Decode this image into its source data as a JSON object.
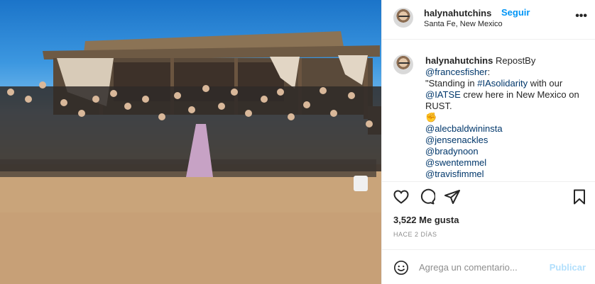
{
  "post": {
    "username": "halynahutchins",
    "separator": "•",
    "follow_label": "Seguir",
    "location": "Santa Fe, New Mexico",
    "more_label": "•••",
    "photo_description": ""
  },
  "caption": {
    "username": "halynahutchins",
    "repost_by": "RepostBy",
    "mention_source": "@francesfisher",
    "line1_suffix": ":",
    "quote_open": "\"Standing in ",
    "hashtag": "#IAsolidarity",
    "quote_mid": " with our",
    "mention_iatse": "@IATSE",
    "quote_end": " crew here in New Mexico on",
    "quote_last": "RUST.",
    "emoji": "✊",
    "mentions": [
      "@alecbaldwininsta",
      "@jensenackles",
      "@bradynoon",
      "@swentemmel",
      "@travisfimmel"
    ]
  },
  "actions": {
    "like_icon": "heart-icon",
    "comment_icon": "comment-icon",
    "share_icon": "share-icon",
    "save_icon": "bookmark-icon"
  },
  "stats": {
    "likes": "3,522 Me gusta",
    "time_ago": "HACE 2 DÍAS"
  },
  "comment": {
    "placeholder": "Agrega un comentario...",
    "post_label": "Publicar"
  },
  "colors": {
    "link": "#00376b",
    "follow": "#0095f6",
    "publish_disabled": "#b2dffc",
    "muted": "#8e8e8e"
  }
}
